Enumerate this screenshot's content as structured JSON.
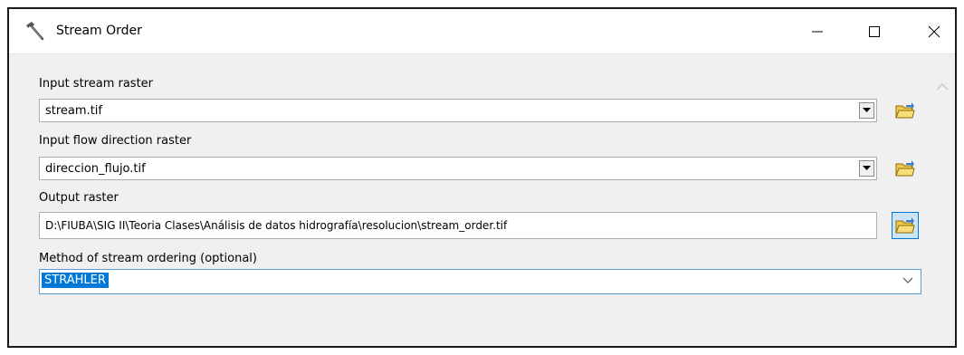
{
  "window": {
    "title": "Stream Order",
    "icon": "hammer-icon"
  },
  "form": {
    "input_stream_raster": {
      "label": "Input stream raster",
      "value": "stream.tif"
    },
    "input_flow_direction": {
      "label": "Input flow direction raster",
      "value": "direccion_flujo.tif"
    },
    "output_raster": {
      "label": "Output raster",
      "value": "D:\\FIUBA\\SIG II\\Teoria Clases\\Análisis de datos hidrografía\\resolucion\\stream_order.tif"
    },
    "method": {
      "label": "Method of stream ordering (optional)",
      "value": "STRAHLER"
    }
  },
  "colors": {
    "selection": "#0078d7",
    "focus_border": "#5b9bd5",
    "folder_yellow": "#f2c94c"
  }
}
